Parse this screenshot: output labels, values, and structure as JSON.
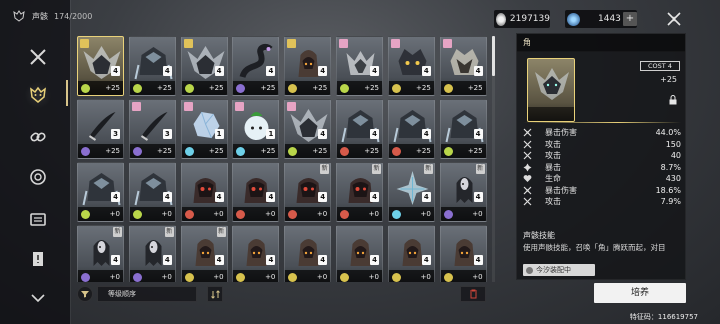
{
  "header": {
    "title": "声骸",
    "count": "174/2000"
  },
  "nav": [
    {
      "name": "nav-weapon",
      "icon": "crossed-swords-icon"
    },
    {
      "name": "nav-echo",
      "icon": "demon-mask-icon"
    },
    {
      "name": "nav-chain",
      "icon": "chain-link-icon"
    },
    {
      "name": "nav-material",
      "icon": "gear-target-icon"
    },
    {
      "name": "nav-consumable",
      "icon": "supply-box-icon"
    },
    {
      "name": "nav-quest",
      "icon": "document-icon"
    },
    {
      "name": "nav-more",
      "icon": "arrow-down-icon"
    }
  ],
  "currency": {
    "coins": "2197139",
    "stars": "1443",
    "stars_add": "+"
  },
  "cards": [
    {
      "lvl": "4",
      "plus": "+25",
      "elem": "#b9d64a",
      "badge": "gold",
      "gold": true,
      "sel": true,
      "art": "dragon"
    },
    {
      "lvl": "4",
      "plus": "+25",
      "elem": "#b9d64a",
      "art": "armor"
    },
    {
      "lvl": "4",
      "plus": "+25",
      "elem": "#b9d64a",
      "badge": "gold",
      "art": "dragon"
    },
    {
      "lvl": "4",
      "plus": "+25",
      "elem": "#8a6fd0",
      "art": "serpent"
    },
    {
      "lvl": "4",
      "plus": "+25",
      "elem": "#d7c24e",
      "badge": "gold",
      "art": "hood"
    },
    {
      "lvl": "4",
      "plus": "+25",
      "elem": "#b9d64a",
      "badge": "pink",
      "art": "wolf"
    },
    {
      "lvl": "4",
      "plus": "+25",
      "elem": "#d7c24e",
      "badge": "pink",
      "art": "beast"
    },
    {
      "lvl": "4",
      "plus": "+25",
      "elem": "#d7c24e",
      "badge": "pink",
      "art": "beast2"
    },
    {
      "lvl": "3",
      "plus": "+25",
      "elem": "#8a6fd0",
      "art": "blade"
    },
    {
      "lvl": "3",
      "plus": "+25",
      "elem": "#8a6fd0",
      "badge": "pink",
      "art": "blade"
    },
    {
      "lvl": "1",
      "plus": "+25",
      "elem": "#6ed0e8",
      "badge": "pink",
      "art": "crystal"
    },
    {
      "lvl": "1",
      "plus": "+25",
      "elem": "#6ed0e8",
      "badge": "pink",
      "art": "plant"
    },
    {
      "lvl": "4",
      "plus": "+25",
      "elem": "#b9d64a",
      "badge": "pink",
      "art": "dragon"
    },
    {
      "lvl": "4",
      "plus": "+25",
      "elem": "#d65a4a",
      "art": "armor"
    },
    {
      "lvl": "4",
      "plus": "+25",
      "elem": "#d65a4a",
      "art": "armor"
    },
    {
      "lvl": "4",
      "plus": "+25",
      "elem": "#b9d64a",
      "art": "armor"
    },
    {
      "lvl": "4",
      "plus": "+0",
      "elem": "#b9d64a",
      "art": "armor"
    },
    {
      "lvl": "4",
      "plus": "+0",
      "elem": "#b9d64a",
      "art": "armor"
    },
    {
      "lvl": "4",
      "plus": "+0",
      "elem": "#d65a4a",
      "art": "redeye"
    },
    {
      "lvl": "4",
      "plus": "+0",
      "elem": "#d65a4a",
      "art": "redeye"
    },
    {
      "lvl": "4",
      "plus": "+0",
      "elem": "#d65a4a",
      "art": "redeye",
      "new": true
    },
    {
      "lvl": "4",
      "plus": "+0",
      "elem": "#d65a4a",
      "art": "redeye",
      "new": true
    },
    {
      "lvl": "4",
      "plus": "+0",
      "elem": "#6ed0e8",
      "art": "ice",
      "new": true
    },
    {
      "lvl": "4",
      "plus": "+0",
      "elem": "#8a6fd0",
      "art": "ghost",
      "new": true
    },
    {
      "lvl": "4",
      "plus": "+0",
      "elem": "#8a6fd0",
      "art": "ghost",
      "new": true
    },
    {
      "lvl": "4",
      "plus": "+0",
      "elem": "#8a6fd0",
      "art": "ghost",
      "new": true
    },
    {
      "lvl": "4",
      "plus": "+0",
      "elem": "#d7c24e",
      "art": "hood",
      "new": true
    },
    {
      "lvl": "4",
      "plus": "+0",
      "elem": "#d7c24e",
      "art": "hood"
    },
    {
      "lvl": "4",
      "plus": "+0",
      "elem": "#d7c24e",
      "art": "hood"
    },
    {
      "lvl": "4",
      "plus": "+0",
      "elem": "#d7c24e",
      "art": "hood"
    },
    {
      "lvl": "4",
      "plus": "+0",
      "elem": "#d7c24e",
      "art": "hood"
    },
    {
      "lvl": "4",
      "plus": "+0",
      "elem": "#d7c24e",
      "art": "hood"
    }
  ],
  "sort": {
    "label": "等级顺序"
  },
  "detail": {
    "name": "角",
    "cost": "COST  4",
    "plus": "+25",
    "stats": [
      {
        "name": "暴击伤害",
        "value": "44.0%",
        "icon": "crit-damage-icon"
      },
      {
        "name": "攻击",
        "value": "150",
        "icon": "attack-icon"
      },
      {
        "name": "攻击",
        "value": "40",
        "icon": "attack-icon"
      },
      {
        "name": "暴击",
        "value": "8.7%",
        "icon": "crit-icon"
      },
      {
        "name": "生命",
        "value": "430",
        "icon": "health-icon"
      },
      {
        "name": "暴击伤害",
        "value": "18.6%",
        "icon": "crit-damage-icon"
      },
      {
        "name": "攻击",
        "value": "7.9%",
        "icon": "attack-icon"
      }
    ],
    "skill_title": "声骸技能",
    "skill_desc": "使用声骸技能，召唤「角」腾跃而起，对目",
    "equipped_by": "今汐装配中"
  },
  "train_label": "培养",
  "uid": "特征码：116619757",
  "colors": {
    "accent_gold": "#e7cf78",
    "selected_border": "#e9d27a"
  }
}
